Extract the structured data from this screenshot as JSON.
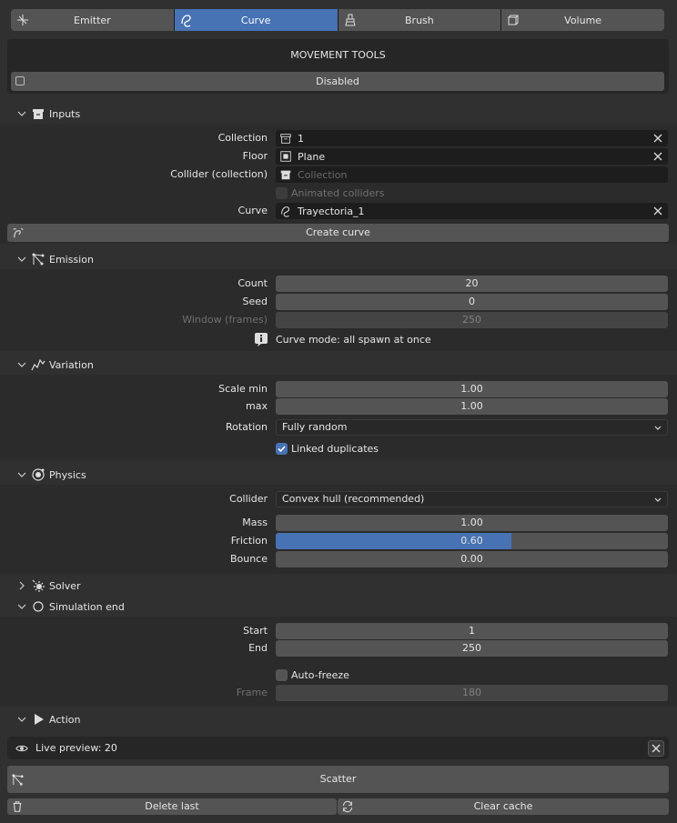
{
  "tabs": [
    {
      "label": "Emitter",
      "icon": "emitter-icon"
    },
    {
      "label": "Curve",
      "icon": "curve-icon"
    },
    {
      "label": "Brush",
      "icon": "brush-icon"
    },
    {
      "label": "Volume",
      "icon": "volume-icon"
    }
  ],
  "active_tab": "Curve",
  "movement": {
    "title": "MOVEMENT TOOLS",
    "toggle_label": "Disabled",
    "enabled": false
  },
  "inputs": {
    "header": "Inputs",
    "collection_label": "Collection",
    "collection_value": "1",
    "floor_label": "Floor",
    "floor_value": "Plane",
    "collider_label": "Collider (collection)",
    "collider_placeholder": "Collection",
    "animated_label": "Animated colliders",
    "animated_checked": false,
    "curve_label": "Curve",
    "curve_value": "Trayectoria_1",
    "create_curve": "Create curve"
  },
  "emission": {
    "header": "Emission",
    "count_label": "Count",
    "count": "20",
    "seed_label": "Seed",
    "seed": "0",
    "window_label": "Window (frames)",
    "window": "250",
    "info": "Curve mode: all spawn at once"
  },
  "variation": {
    "header": "Variation",
    "scale_min_label": "Scale min",
    "scale_min": "1.00",
    "scale_max_label": "max",
    "scale_max": "1.00",
    "rotation_label": "Rotation",
    "rotation": "Fully random",
    "linked_label": "Linked duplicates",
    "linked_checked": true
  },
  "physics": {
    "header": "Physics",
    "collider_label": "Collider",
    "collider": "Convex hull (recommended)",
    "mass_label": "Mass",
    "mass": "1.00",
    "friction_label": "Friction",
    "friction": "0.60",
    "friction_fraction": 0.6,
    "bounce_label": "Bounce",
    "bounce": "0.00"
  },
  "solver": {
    "header": "Solver"
  },
  "simulation_end": {
    "header": "Simulation end",
    "start_label": "Start",
    "start": "1",
    "end_label": "End",
    "end": "250",
    "autofreeze_label": "Auto-freeze",
    "autofreeze_checked": false,
    "frame_label": "Frame",
    "frame": "180"
  },
  "action": {
    "header": "Action",
    "live_preview": "Live preview: 20",
    "scatter": "Scatter",
    "delete_last": "Delete last",
    "clear_cache": "Clear cache"
  },
  "colors": {
    "accent": "#4772b3",
    "bg": "#303030",
    "field": "#1d1d1d",
    "button": "#545454"
  }
}
